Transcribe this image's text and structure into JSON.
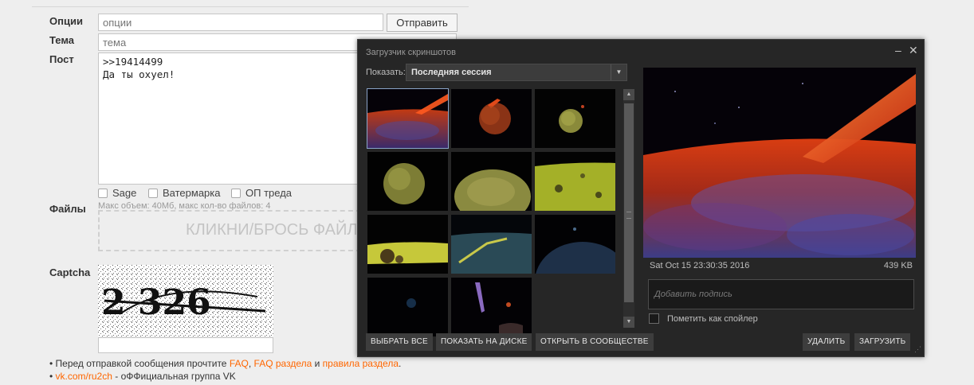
{
  "form": {
    "labels": {
      "options": "Опции",
      "subject": "Тема",
      "post": "Пост",
      "files": "Файлы",
      "captcha": "Captcha"
    },
    "options_placeholder": "опции",
    "subject_placeholder": "тема",
    "send_button": "Отправить",
    "post_text": ">>19414499\nДа ты охуел!",
    "checkboxes": {
      "sage": "Sage",
      "watermark": "Ватермарка",
      "op": "ОП треда"
    },
    "file_limits": "Макс объем: 40Мб, макс кол-во файлов: 4",
    "dropzone_text": "КЛИКНИ/БРОСЬ ФАЙЛ",
    "captcha_text": "2 326",
    "notes": {
      "before": "• Перед отправкой сообщения прочтите",
      "faq": "FAQ",
      "comma": ",",
      "faq_section": "FAQ раздела",
      "and": "и",
      "rules": "правила раздела",
      "period": ".",
      "vk_link": "vk.com/ru2ch",
      "vk_rest": "- оФФициальная группа VK"
    }
  },
  "uploader": {
    "title": "Загрузчик скриншотов",
    "controls": {
      "minimize": "‒",
      "close": "✕"
    },
    "show_label": "Показать:",
    "session_select": "Последняя сессия",
    "preview_date": "Sat Oct 15 23:30:35 2016",
    "preview_size": "439 KB",
    "caption_placeholder": "Добавить подпись",
    "spoiler_label": "Пометить как спойлер",
    "buttons": {
      "select_all": "ВЫБРАТЬ ВСЕ",
      "show_on_disk": "ПОКАЗАТЬ НА ДИСКЕ",
      "open_community": "ОТКРЫТЬ В СООБЩЕСТВЕ",
      "delete": "УДАЛИТЬ",
      "upload": "ЗАГРУЗИТЬ"
    },
    "thumbnails": [
      "red-planet-surface",
      "red-planet",
      "green-planet-small",
      "green-planet",
      "green-planet-close",
      "green-planet-terrain",
      "green-horizon",
      "green-terrain-dark",
      "dark-planet-limb",
      "dark-space",
      "space-beam"
    ],
    "selected_index": 0
  }
}
